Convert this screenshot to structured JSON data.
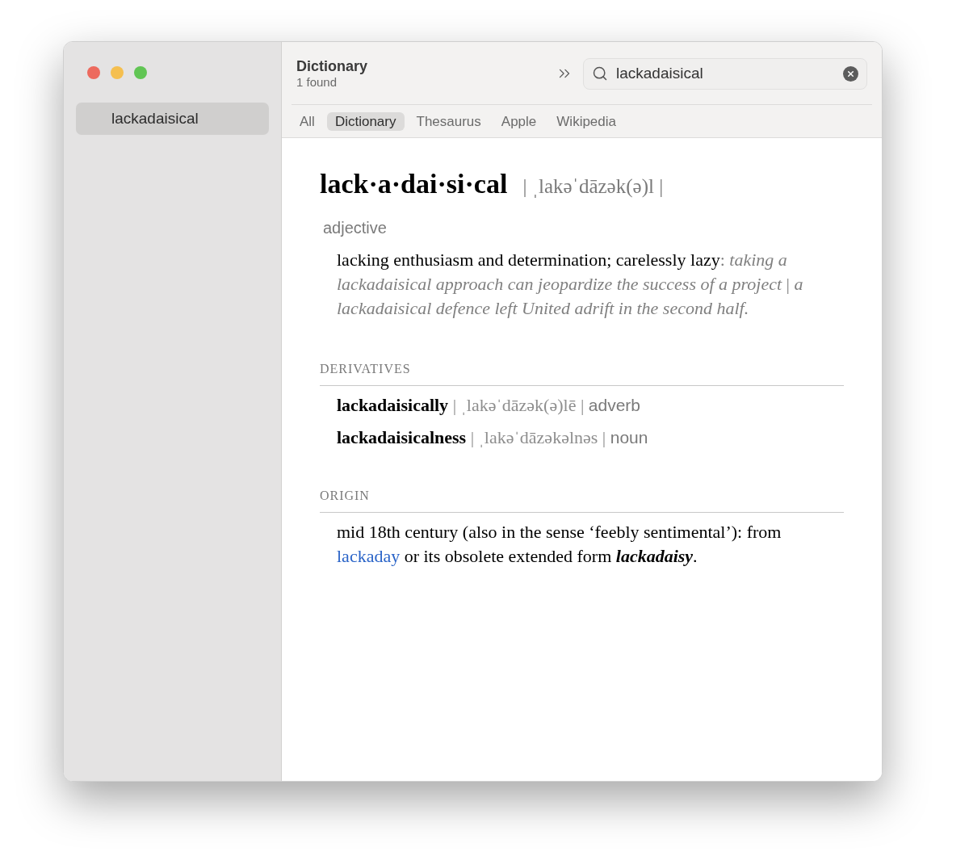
{
  "window": {
    "controls": [
      {
        "color": "#ed6a5e"
      },
      {
        "color": "#f5bf4f"
      },
      {
        "color": "#61c554"
      }
    ]
  },
  "sidebar": {
    "items": [
      {
        "label": "lackadaisical",
        "selected": true
      }
    ]
  },
  "header": {
    "title": "Dictionary",
    "subtitle": "1 found"
  },
  "search": {
    "value": "lackadaisical"
  },
  "tabs": [
    {
      "label": "All",
      "selected": false
    },
    {
      "label": "Dictionary",
      "selected": true
    },
    {
      "label": "Thesaurus",
      "selected": false
    },
    {
      "label": "Apple",
      "selected": false
    },
    {
      "label": "Wikipedia",
      "selected": false
    }
  ],
  "entry": {
    "headword": "lack·a·dai·si·cal",
    "pronunciation": "| ˌlakəˈdāzək(ə)l |",
    "senses": [
      {
        "part_of_speech": "adjective",
        "definition": "lacking enthusiasm and determination; carelessly lazy",
        "example": ": *taking a lackadaisical approach can jeopardize the success of a project* | *a lackadaisical defence left United adrift in the second half.*"
      }
    ],
    "derivatives": {
      "heading": "DERIVATIVES",
      "items": [
        {
          "word": "lackadaisically",
          "pronunciation": "| ˌlakəˈdāzək(ə)lē |",
          "part_of_speech": "adverb"
        },
        {
          "word": "lackadaisicalness",
          "pronunciation": "| ˌlakəˈdāzəkəlnəs |",
          "part_of_speech": "noun"
        }
      ]
    },
    "origin": {
      "heading": "ORIGIN",
      "before": "mid 18th century (also in the sense ‘feebly sentimental’): from",
      "link": "lackaday",
      "after": "or its obsolete extended form **lackadaisy**."
    }
  }
}
